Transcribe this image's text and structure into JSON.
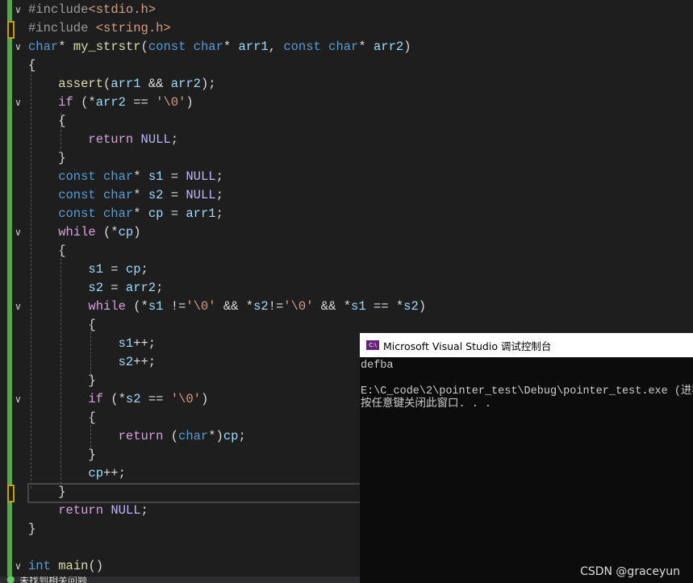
{
  "editor": {
    "lines": [
      {
        "fold": true,
        "tokens": [
          [
            "#include",
            "p"
          ],
          [
            "<stdio.h>",
            "s"
          ]
        ]
      },
      {
        "fold": false,
        "mark": true,
        "tokens": [
          [
            "#include ",
            "p"
          ],
          [
            "<string.h>",
            "s"
          ]
        ]
      },
      {
        "fold": true,
        "tokens": [
          [
            "char",
            "k"
          ],
          [
            "* ",
            "t"
          ],
          [
            "my_strstr",
            "f"
          ],
          [
            "(",
            "t"
          ],
          [
            "const ",
            "k"
          ],
          [
            "char",
            "k"
          ],
          [
            "* ",
            "t"
          ],
          [
            "arr1",
            "v"
          ],
          [
            ", ",
            "t"
          ],
          [
            "const ",
            "k"
          ],
          [
            "char",
            "k"
          ],
          [
            "* ",
            "t"
          ],
          [
            "arr2",
            "v"
          ],
          [
            ")",
            "t"
          ]
        ]
      },
      {
        "tokens": [
          [
            "{",
            "t"
          ]
        ]
      },
      {
        "indent": 1,
        "tokens": [
          [
            "assert",
            "f"
          ],
          [
            "(",
            "t"
          ],
          [
            "arr1",
            "v"
          ],
          [
            " && ",
            "t"
          ],
          [
            "arr2",
            "v"
          ],
          [
            ");",
            "t"
          ]
        ]
      },
      {
        "indent": 1,
        "fold": true,
        "tokens": [
          [
            "if",
            "c"
          ],
          [
            " (*",
            "t"
          ],
          [
            "arr2",
            "v"
          ],
          [
            " == ",
            "t"
          ],
          [
            "'\\0'",
            "s"
          ],
          [
            ")",
            "t"
          ]
        ]
      },
      {
        "indent": 1,
        "tokens": [
          [
            "{",
            "t"
          ]
        ]
      },
      {
        "indent": 2,
        "tokens": [
          [
            "return ",
            "c"
          ],
          [
            "NULL",
            "m"
          ],
          [
            ";",
            "t"
          ]
        ]
      },
      {
        "indent": 1,
        "tokens": [
          [
            "}",
            "t"
          ]
        ]
      },
      {
        "indent": 1,
        "tokens": [
          [
            "const ",
            "k"
          ],
          [
            "char",
            "k"
          ],
          [
            "* ",
            "t"
          ],
          [
            "s1",
            "v"
          ],
          [
            " = ",
            "t"
          ],
          [
            "NULL",
            "m"
          ],
          [
            ";",
            "t"
          ]
        ]
      },
      {
        "indent": 1,
        "tokens": [
          [
            "const ",
            "k"
          ],
          [
            "char",
            "k"
          ],
          [
            "* ",
            "t"
          ],
          [
            "s2",
            "v"
          ],
          [
            " = ",
            "t"
          ],
          [
            "NULL",
            "m"
          ],
          [
            ";",
            "t"
          ]
        ]
      },
      {
        "indent": 1,
        "tokens": [
          [
            "const ",
            "k"
          ],
          [
            "char",
            "k"
          ],
          [
            "* ",
            "t"
          ],
          [
            "cp",
            "v"
          ],
          [
            " = ",
            "t"
          ],
          [
            "arr1",
            "v"
          ],
          [
            ";",
            "t"
          ]
        ]
      },
      {
        "indent": 1,
        "fold": true,
        "tokens": [
          [
            "while",
            "c"
          ],
          [
            " (*",
            "t"
          ],
          [
            "cp",
            "v"
          ],
          [
            ")",
            "t"
          ]
        ]
      },
      {
        "indent": 1,
        "tokens": [
          [
            "{",
            "t"
          ]
        ]
      },
      {
        "indent": 2,
        "tokens": [
          [
            "s1",
            "v"
          ],
          [
            " = ",
            "t"
          ],
          [
            "cp",
            "v"
          ],
          [
            ";",
            "t"
          ]
        ]
      },
      {
        "indent": 2,
        "tokens": [
          [
            "s2",
            "v"
          ],
          [
            " = ",
            "t"
          ],
          [
            "arr2",
            "v"
          ],
          [
            ";",
            "t"
          ]
        ]
      },
      {
        "indent": 2,
        "fold": true,
        "tokens": [
          [
            "while",
            "c"
          ],
          [
            " (*",
            "t"
          ],
          [
            "s1",
            "v"
          ],
          [
            " !=",
            "t"
          ],
          [
            "'\\0'",
            "s"
          ],
          [
            " && *",
            "t"
          ],
          [
            "s2",
            "v"
          ],
          [
            "!=",
            "t"
          ],
          [
            "'\\0'",
            "s"
          ],
          [
            " && *",
            "t"
          ],
          [
            "s1",
            "v"
          ],
          [
            " == *",
            "t"
          ],
          [
            "s2",
            "v"
          ],
          [
            ")",
            "t"
          ]
        ]
      },
      {
        "indent": 2,
        "tokens": [
          [
            "{",
            "t"
          ]
        ]
      },
      {
        "indent": 3,
        "tokens": [
          [
            "s1",
            "v"
          ],
          [
            "++;",
            "t"
          ]
        ]
      },
      {
        "indent": 3,
        "tokens": [
          [
            "s2",
            "v"
          ],
          [
            "++;",
            "t"
          ]
        ]
      },
      {
        "indent": 2,
        "tokens": [
          [
            "}",
            "t"
          ]
        ]
      },
      {
        "indent": 2,
        "fold": true,
        "tokens": [
          [
            "if",
            "c"
          ],
          [
            " (*",
            "t"
          ],
          [
            "s2",
            "v"
          ],
          [
            " == ",
            "t"
          ],
          [
            "'\\0'",
            "s"
          ],
          [
            ")",
            "t"
          ]
        ]
      },
      {
        "indent": 2,
        "tokens": [
          [
            "{",
            "t"
          ]
        ]
      },
      {
        "indent": 3,
        "tokens": [
          [
            "return ",
            "c"
          ],
          [
            "(",
            "t"
          ],
          [
            "char",
            "k"
          ],
          [
            "*)",
            "t"
          ],
          [
            "cp",
            "v"
          ],
          [
            ";",
            "t"
          ]
        ]
      },
      {
        "indent": 2,
        "tokens": [
          [
            "}",
            "t"
          ]
        ]
      },
      {
        "indent": 2,
        "tokens": [
          [
            "cp",
            "v"
          ],
          [
            "++;",
            "t"
          ]
        ]
      },
      {
        "indent": 1,
        "mark": true,
        "tokens": [
          [
            "}",
            "t"
          ]
        ]
      },
      {
        "indent": 1,
        "tokens": [
          [
            "return ",
            "c"
          ],
          [
            "NULL",
            "m"
          ],
          [
            ";",
            "t"
          ]
        ]
      },
      {
        "tokens": [
          [
            "}",
            "t"
          ]
        ]
      },
      {
        "tokens": []
      },
      {
        "fold": true,
        "tokens": [
          [
            "int ",
            "k"
          ],
          [
            "main",
            "f"
          ],
          [
            "()",
            "t"
          ]
        ]
      }
    ]
  },
  "console": {
    "icon": "C:\\",
    "title": "Microsoft Visual Studio 调试控制台",
    "lines": [
      "defba",
      "",
      "E:\\C_code\\2\\pointer_test\\Debug\\pointer_test.exe (进程",
      "按任意键关闭此窗口. . ."
    ]
  },
  "status": {
    "issues": "未找到相关问题"
  },
  "watermark": "CSDN @graceyun"
}
